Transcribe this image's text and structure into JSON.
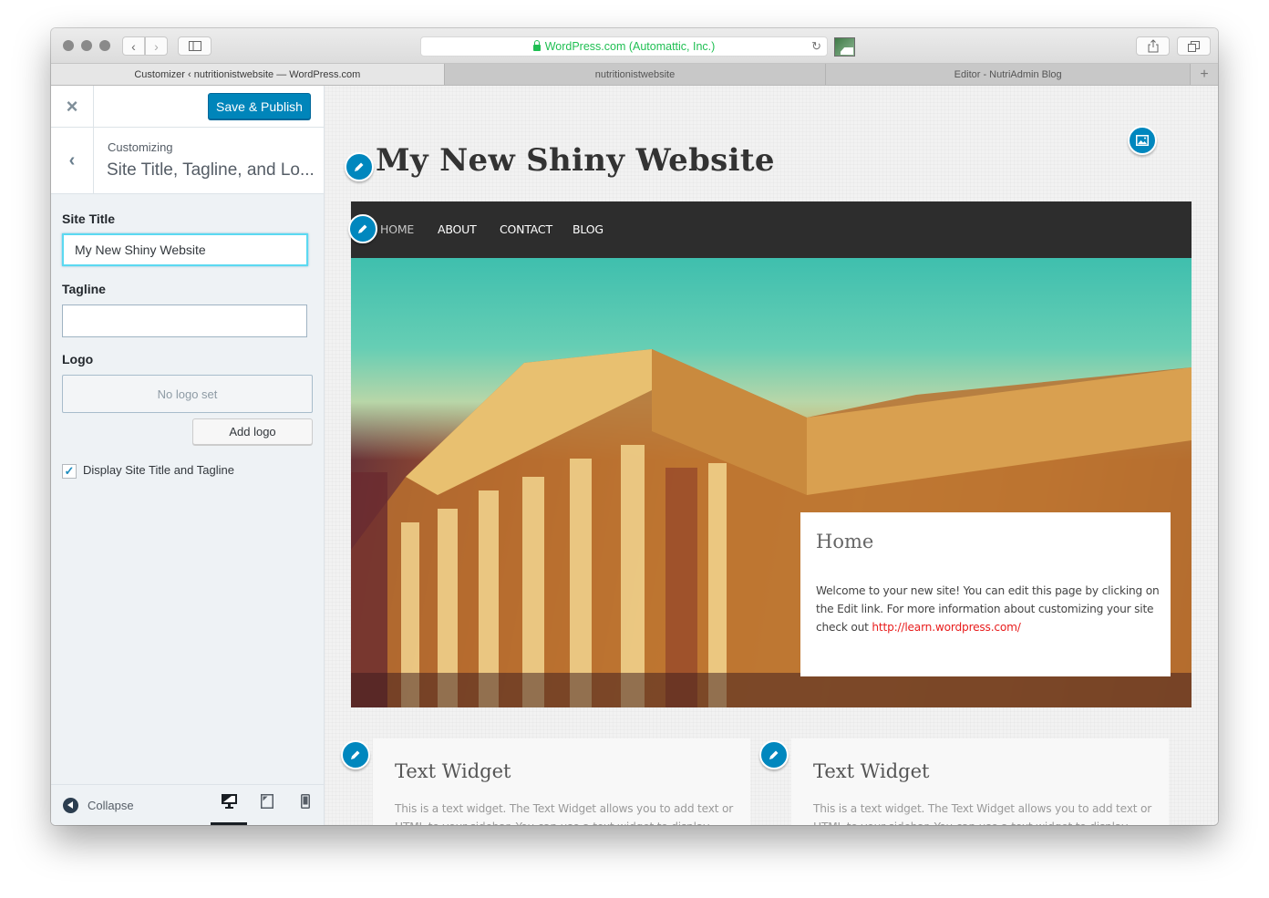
{
  "browser": {
    "address": "WordPress.com (Automattic, Inc.)",
    "tabs": [
      {
        "label": "Customizer ‹ nutritionistwebsite — WordPress.com",
        "active": true
      },
      {
        "label": "nutritionistwebsite",
        "active": false
      },
      {
        "label": "Editor - NutriAdmin Blog",
        "active": false
      }
    ],
    "icons": {
      "back": "chevron-left-icon",
      "forward": "chevron-right-icon",
      "sidebar": "sidebar-icon",
      "reload": "reload-icon",
      "share": "share-icon",
      "tabs_overview": "tabs-overview-icon",
      "new_tab": "plus-icon"
    }
  },
  "customizer": {
    "close_icon": "×",
    "publish_label": "Save & Publish",
    "back_icon": "‹",
    "breadcrumb_label": "Customizing",
    "section_title": "Site Title, Tagline, and Lo...",
    "fields": {
      "site_title_label": "Site Title",
      "site_title_value": "My New Shiny Website",
      "tagline_label": "Tagline",
      "tagline_value": "",
      "logo_label": "Logo",
      "no_logo_text": "No logo set",
      "add_logo_label": "Add logo",
      "display_checkbox_label": "Display Site Title and Tagline",
      "display_checked": true
    },
    "footer": {
      "collapse_label": "Collapse",
      "devices": [
        "desktop",
        "tablet",
        "mobile"
      ],
      "active_device": "desktop"
    },
    "accent_color": "#0085ba"
  },
  "preview": {
    "site_title": "My New Shiny Website",
    "nav": [
      "HOME",
      "ABOUT",
      "CONTACT",
      "BLOG"
    ],
    "current_nav": "HOME",
    "hero_card": {
      "title": "Home",
      "text": "Welcome to your new site! You can edit this page by clicking on the Edit link. For more information about customizing your site check out ",
      "link": "http://learn.wordpress.com/"
    },
    "widgets": [
      {
        "title": "Text Widget",
        "text": "This is a text widget. The Text Widget allows you to add text or HTML to your sidebar. You can use a text widget to display"
      },
      {
        "title": "Text Widget",
        "text": "This is a text widget. The Text Widget allows you to add text or HTML to your sidebar. You can use a text widget to display"
      }
    ],
    "link_color": "#e81d1d",
    "edit_bubble_color": "#0087be"
  }
}
